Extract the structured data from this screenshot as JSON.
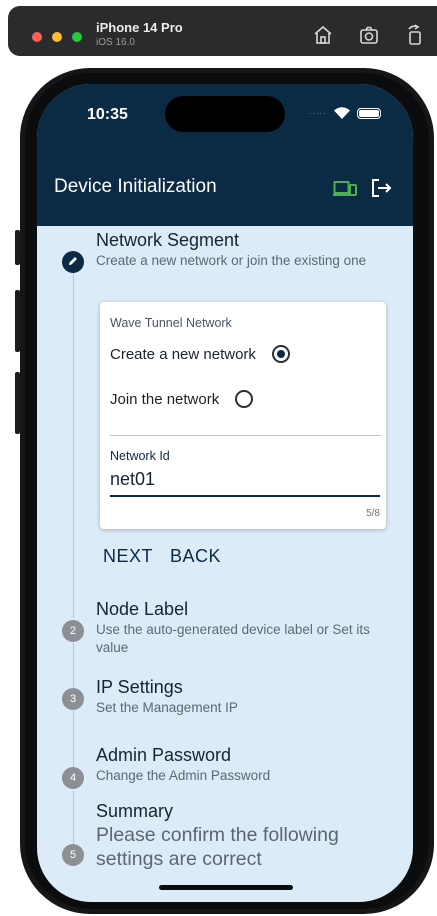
{
  "simulator": {
    "device_name": "iPhone 14 Pro",
    "os_version": "iOS 16.0"
  },
  "status_bar": {
    "time": "10:35",
    "signal": "....."
  },
  "app_bar": {
    "title": "Device Initialization"
  },
  "stepper": {
    "steps": [
      {
        "number": "1",
        "title": "Network Segment",
        "subtitle": "Create a new network or join the existing one",
        "state": "active",
        "icon": "pencil-icon"
      },
      {
        "number": "2",
        "title": "Node Label",
        "subtitle": "Use the auto-generated device label or Set its value",
        "state": "pending"
      },
      {
        "number": "3",
        "title": "IP Settings",
        "subtitle": "Set the Management IP",
        "state": "pending"
      },
      {
        "number": "4",
        "title": "Admin Password",
        "subtitle": "Change the Admin Password",
        "state": "pending"
      },
      {
        "number": "5",
        "title": "Summary",
        "subtitle": "Please confirm the following settings are correct",
        "state": "pending"
      }
    ]
  },
  "network_form": {
    "group_label": "Wave Tunnel Network",
    "options": [
      {
        "label": "Create a new network",
        "selected": true
      },
      {
        "label": "Join the network",
        "selected": false
      }
    ],
    "network_id_label": "Network Id",
    "network_id_value": "net01",
    "counter": "5/8"
  },
  "actions": {
    "next_label": "NEXT",
    "back_label": "BACK"
  },
  "colors": {
    "app_bar": "#0b2a44",
    "screen_background": "#dcebf8",
    "device_icon": "#4caf50"
  }
}
